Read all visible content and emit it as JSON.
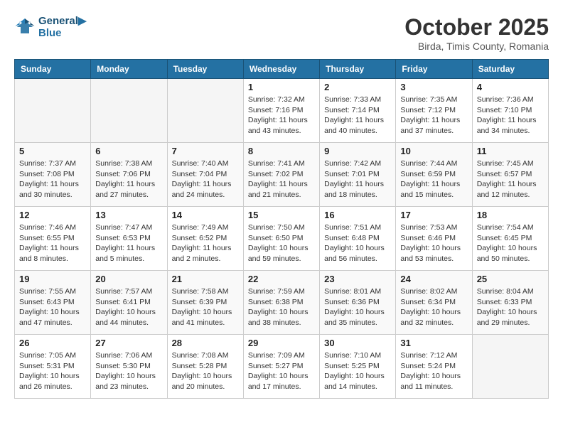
{
  "header": {
    "logo_line1": "General",
    "logo_line2": "Blue",
    "month": "October 2025",
    "location": "Birda, Timis County, Romania"
  },
  "weekdays": [
    "Sunday",
    "Monday",
    "Tuesday",
    "Wednesday",
    "Thursday",
    "Friday",
    "Saturday"
  ],
  "weeks": [
    [
      {
        "day": "",
        "info": ""
      },
      {
        "day": "",
        "info": ""
      },
      {
        "day": "",
        "info": ""
      },
      {
        "day": "1",
        "info": "Sunrise: 7:32 AM\nSunset: 7:16 PM\nDaylight: 11 hours\nand 43 minutes."
      },
      {
        "day": "2",
        "info": "Sunrise: 7:33 AM\nSunset: 7:14 PM\nDaylight: 11 hours\nand 40 minutes."
      },
      {
        "day": "3",
        "info": "Sunrise: 7:35 AM\nSunset: 7:12 PM\nDaylight: 11 hours\nand 37 minutes."
      },
      {
        "day": "4",
        "info": "Sunrise: 7:36 AM\nSunset: 7:10 PM\nDaylight: 11 hours\nand 34 minutes."
      }
    ],
    [
      {
        "day": "5",
        "info": "Sunrise: 7:37 AM\nSunset: 7:08 PM\nDaylight: 11 hours\nand 30 minutes."
      },
      {
        "day": "6",
        "info": "Sunrise: 7:38 AM\nSunset: 7:06 PM\nDaylight: 11 hours\nand 27 minutes."
      },
      {
        "day": "7",
        "info": "Sunrise: 7:40 AM\nSunset: 7:04 PM\nDaylight: 11 hours\nand 24 minutes."
      },
      {
        "day": "8",
        "info": "Sunrise: 7:41 AM\nSunset: 7:02 PM\nDaylight: 11 hours\nand 21 minutes."
      },
      {
        "day": "9",
        "info": "Sunrise: 7:42 AM\nSunset: 7:01 PM\nDaylight: 11 hours\nand 18 minutes."
      },
      {
        "day": "10",
        "info": "Sunrise: 7:44 AM\nSunset: 6:59 PM\nDaylight: 11 hours\nand 15 minutes."
      },
      {
        "day": "11",
        "info": "Sunrise: 7:45 AM\nSunset: 6:57 PM\nDaylight: 11 hours\nand 12 minutes."
      }
    ],
    [
      {
        "day": "12",
        "info": "Sunrise: 7:46 AM\nSunset: 6:55 PM\nDaylight: 11 hours\nand 8 minutes."
      },
      {
        "day": "13",
        "info": "Sunrise: 7:47 AM\nSunset: 6:53 PM\nDaylight: 11 hours\nand 5 minutes."
      },
      {
        "day": "14",
        "info": "Sunrise: 7:49 AM\nSunset: 6:52 PM\nDaylight: 11 hours\nand 2 minutes."
      },
      {
        "day": "15",
        "info": "Sunrise: 7:50 AM\nSunset: 6:50 PM\nDaylight: 10 hours\nand 59 minutes."
      },
      {
        "day": "16",
        "info": "Sunrise: 7:51 AM\nSunset: 6:48 PM\nDaylight: 10 hours\nand 56 minutes."
      },
      {
        "day": "17",
        "info": "Sunrise: 7:53 AM\nSunset: 6:46 PM\nDaylight: 10 hours\nand 53 minutes."
      },
      {
        "day": "18",
        "info": "Sunrise: 7:54 AM\nSunset: 6:45 PM\nDaylight: 10 hours\nand 50 minutes."
      }
    ],
    [
      {
        "day": "19",
        "info": "Sunrise: 7:55 AM\nSunset: 6:43 PM\nDaylight: 10 hours\nand 47 minutes."
      },
      {
        "day": "20",
        "info": "Sunrise: 7:57 AM\nSunset: 6:41 PM\nDaylight: 10 hours\nand 44 minutes."
      },
      {
        "day": "21",
        "info": "Sunrise: 7:58 AM\nSunset: 6:39 PM\nDaylight: 10 hours\nand 41 minutes."
      },
      {
        "day": "22",
        "info": "Sunrise: 7:59 AM\nSunset: 6:38 PM\nDaylight: 10 hours\nand 38 minutes."
      },
      {
        "day": "23",
        "info": "Sunrise: 8:01 AM\nSunset: 6:36 PM\nDaylight: 10 hours\nand 35 minutes."
      },
      {
        "day": "24",
        "info": "Sunrise: 8:02 AM\nSunset: 6:34 PM\nDaylight: 10 hours\nand 32 minutes."
      },
      {
        "day": "25",
        "info": "Sunrise: 8:04 AM\nSunset: 6:33 PM\nDaylight: 10 hours\nand 29 minutes."
      }
    ],
    [
      {
        "day": "26",
        "info": "Sunrise: 7:05 AM\nSunset: 5:31 PM\nDaylight: 10 hours\nand 26 minutes."
      },
      {
        "day": "27",
        "info": "Sunrise: 7:06 AM\nSunset: 5:30 PM\nDaylight: 10 hours\nand 23 minutes."
      },
      {
        "day": "28",
        "info": "Sunrise: 7:08 AM\nSunset: 5:28 PM\nDaylight: 10 hours\nand 20 minutes."
      },
      {
        "day": "29",
        "info": "Sunrise: 7:09 AM\nSunset: 5:27 PM\nDaylight: 10 hours\nand 17 minutes."
      },
      {
        "day": "30",
        "info": "Sunrise: 7:10 AM\nSunset: 5:25 PM\nDaylight: 10 hours\nand 14 minutes."
      },
      {
        "day": "31",
        "info": "Sunrise: 7:12 AM\nSunset: 5:24 PM\nDaylight: 10 hours\nand 11 minutes."
      },
      {
        "day": "",
        "info": ""
      }
    ]
  ]
}
